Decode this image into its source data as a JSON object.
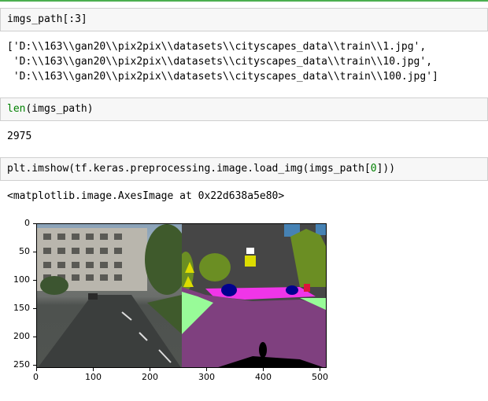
{
  "cells": [
    {
      "input": "imgs_path[:3]",
      "output_lines": [
        "['D:\\\\163\\\\gan20\\\\pix2pix\\\\datasets\\\\cityscapes_data\\\\train\\\\1.jpg',",
        " 'D:\\\\163\\\\gan20\\\\pix2pix\\\\datasets\\\\cityscapes_data\\\\train\\\\10.jpg',",
        " 'D:\\\\163\\\\gan20\\\\pix2pix\\\\datasets\\\\cityscapes_data\\\\train\\\\100.jpg']"
      ]
    },
    {
      "input_kw": "len",
      "input_rest": "(imgs_path)",
      "output": "2975"
    },
    {
      "input_pre": "plt.imshow(tf.keras.preprocessing.image.load_img(imgs_path[",
      "input_num": "0",
      "input_post": "]))",
      "output": "<matplotlib.image.AxesImage at 0x22d638a5e80>"
    }
  ],
  "plot": {
    "y_ticks": [
      "0",
      "50",
      "100",
      "150",
      "200",
      "250"
    ],
    "x_ticks": [
      "0",
      "100",
      "200",
      "300",
      "400",
      "500"
    ]
  },
  "colors": {
    "green_rule": "#4caf50",
    "keyword": "#008000",
    "cell_bg": "#f7f7f7"
  }
}
